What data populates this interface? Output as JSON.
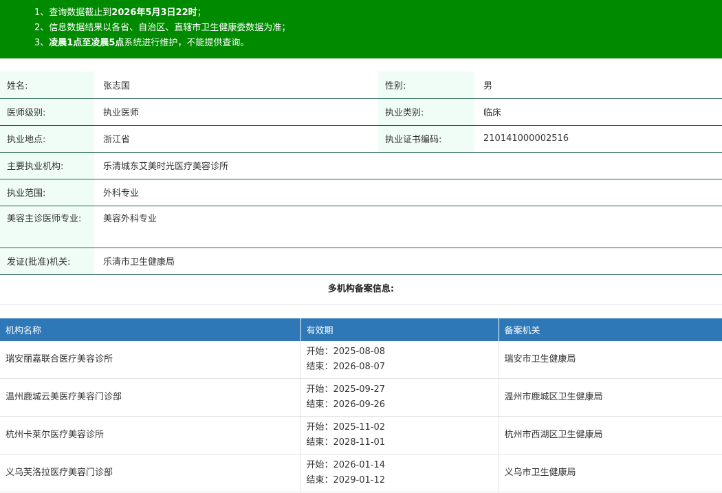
{
  "notice": {
    "line1_prefix": "1、查询数据截止到",
    "line1_bold": "2026年5月3日22时",
    "line1_suffix": "；",
    "line2": "2、信息数据结果以各省、自治区、直辖市卫生健康委数据为准；",
    "line3_prefix": "3、",
    "line3_bold": "凌晨1点至凌晨5点",
    "line3_suffix": "系统进行维护，不能提供查询。"
  },
  "doctor": {
    "name_label": "姓名:",
    "name": "张志国",
    "gender_label": "性别:",
    "gender": "男",
    "level_label": "医师级别:",
    "level": "执业医师",
    "category_label": "执业类别:",
    "category": "临床",
    "location_label": "执业地点:",
    "location": "浙江省",
    "cert_label": "执业证书编码:",
    "cert": "210141000002516",
    "org_label": "主要执业机构:",
    "org": "乐清城东艾美时光医疗美容诊所",
    "scope_label": "执业范围:",
    "scope": "外科专业",
    "cosmetic_label": "美容主诊医师专业:",
    "cosmetic": "美容外科专业",
    "issuer_label": "发证(批准)机关:",
    "issuer": "乐清市卫生健康局"
  },
  "multi": {
    "title": "多机构备案信息:",
    "headers": [
      "机构名称",
      "有效期",
      "备案机关"
    ],
    "rows": [
      {
        "name": "瑞安丽嘉联合医疗美容诊所",
        "start": "开始：2025-08-08",
        "end": "结束：2026-08-07",
        "authority": "瑞安市卫生健康局"
      },
      {
        "name": "温州鹿城云美医疗美容门诊部",
        "start": "开始：2025-09-27",
        "end": "结束：2026-09-26",
        "authority": "温州市鹿城区卫生健康局"
      },
      {
        "name": "杭州卡莱尔医疗美容诊所",
        "start": "开始：2025-11-02",
        "end": "结束：2028-11-01",
        "authority": "杭州市西湖区卫生健康局"
      },
      {
        "name": "义乌芙洛拉医疗美容门诊部",
        "start": "开始：2026-01-14",
        "end": "结束：2029-01-12",
        "authority": "义乌市卫生健康局"
      }
    ]
  }
}
